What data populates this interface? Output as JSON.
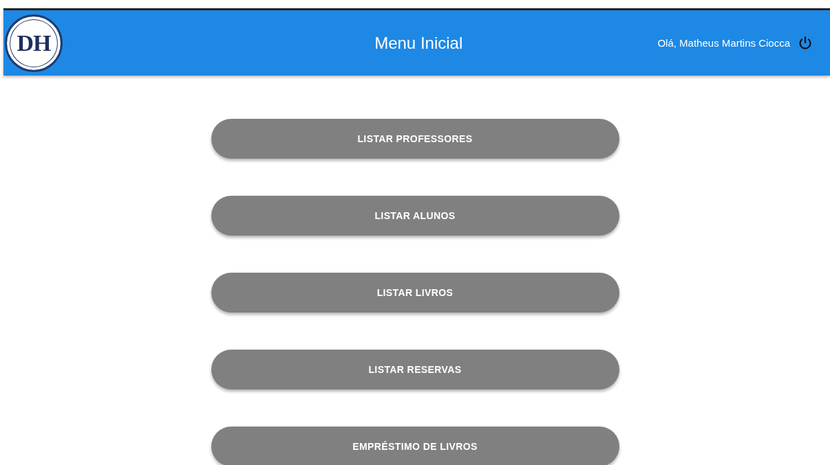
{
  "header": {
    "logo_text": "DH",
    "title": "Menu Inicial",
    "greeting": "Olá, Matheus Martins Ciocca"
  },
  "menu_buttons": [
    {
      "label": "LISTAR PROFESSORES"
    },
    {
      "label": "LISTAR ALUNOS"
    },
    {
      "label": "LISTAR LIVROS"
    },
    {
      "label": "LISTAR RESERVAS"
    },
    {
      "label": "EMPRÉSTIMO DE LIVROS"
    }
  ]
}
